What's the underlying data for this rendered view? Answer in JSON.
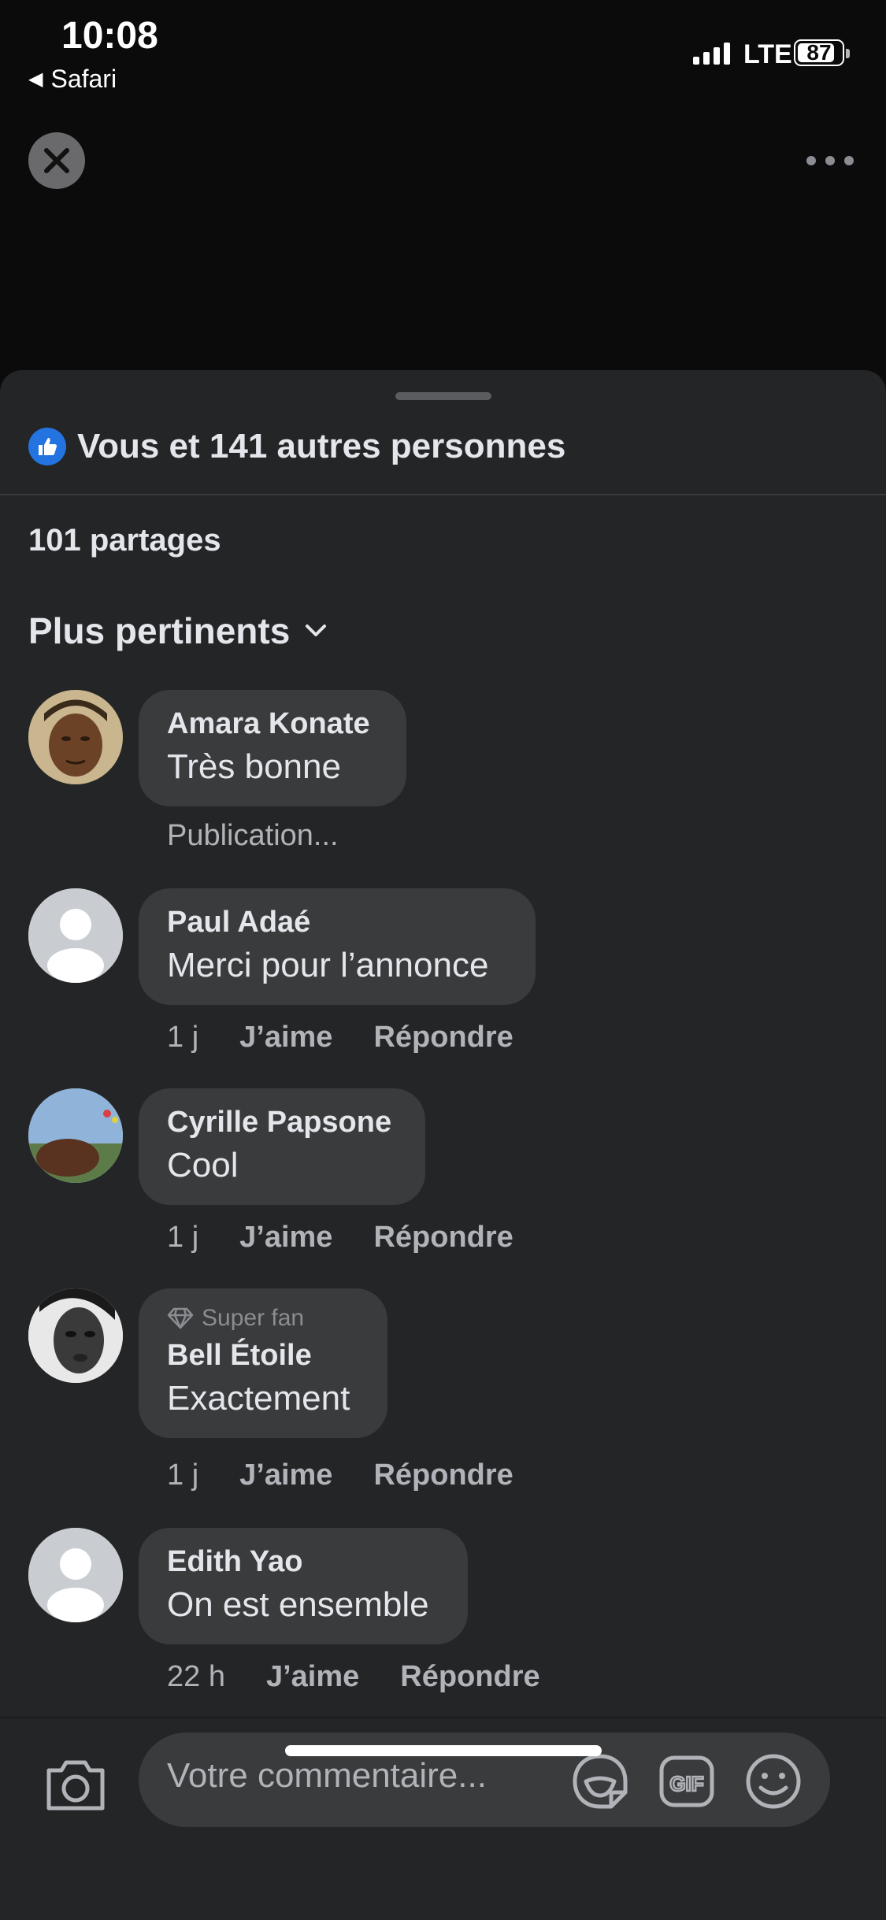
{
  "status_bar": {
    "time": "10:08",
    "back_app": "Safari",
    "network": "LTE",
    "battery": "87",
    "battery_level": 0.87
  },
  "sheet": {
    "likes_text": "Vous et 141 autres personnes",
    "shares": "101 partages",
    "sort_label": "Plus pertinents"
  },
  "comments": [
    {
      "name": "Amara Konate",
      "text": "Très bonne",
      "status": "Publication..."
    },
    {
      "name": "Paul Adaé",
      "text": "Merci pour l’annonce",
      "time": "1 j",
      "like": "J’aime",
      "reply": "Répondre"
    },
    {
      "name": "Cyrille Papsone",
      "text": "Cool",
      "time": "1 j",
      "like": "J’aime",
      "reply": "Répondre"
    },
    {
      "badge": "Super fan",
      "name": "Bell Étoile",
      "text": "Exactement",
      "time": "1 j",
      "like": "J’aime",
      "reply": "Répondre"
    },
    {
      "name": "Edith Yao",
      "text": "On est ensemble",
      "time": "22 h",
      "like": "J’aime",
      "reply": "Répondre"
    }
  ],
  "composer": {
    "placeholder": "Votre commentaire...",
    "icons": [
      "camera-icon",
      "sticker-icon",
      "gif-icon",
      "emoji-icon"
    ],
    "gif_label": "GIF"
  },
  "colors": {
    "sheet_bg": "#242526",
    "bubble_bg": "#3a3b3c",
    "accent": "#2374e1"
  }
}
